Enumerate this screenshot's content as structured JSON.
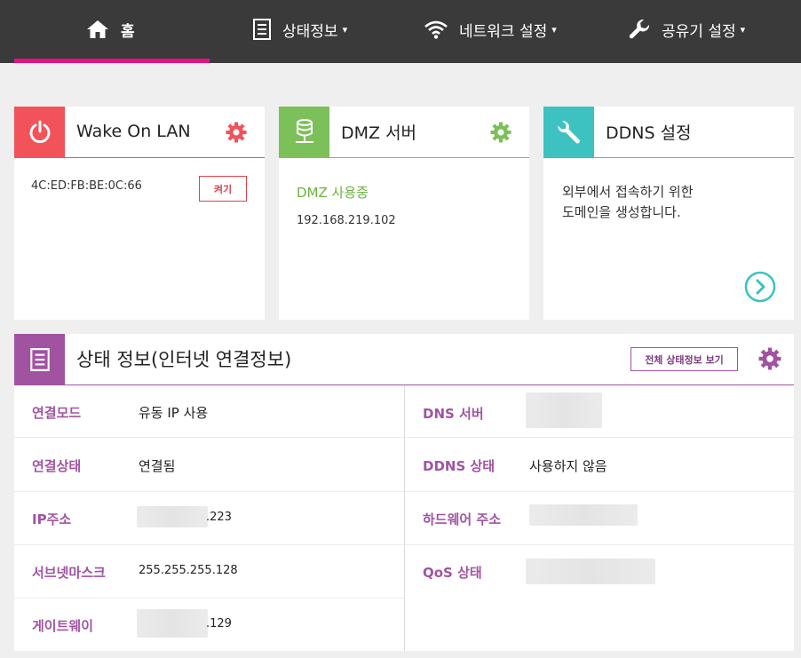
{
  "nav": {
    "home": "홈",
    "status": "상태정보",
    "network": "네트워크 설정",
    "router": "공유기 설정",
    "caret": "▾"
  },
  "wol": {
    "title": "Wake On LAN",
    "mac": "4C:ED:FB:BE:0C:66",
    "button": "켜기"
  },
  "dmz": {
    "title": "DMZ 서버",
    "status": "DMZ 사용중",
    "ip": "192.168.219.102"
  },
  "ddns": {
    "title": "DDNS 설정",
    "description_line1": "외부에서 접속하기 위한",
    "description_line2": "도메인을 생성합니다."
  },
  "status": {
    "title": "상태 정보(인터넷 연결정보)",
    "full_button": "전체 상태정보 보기",
    "left": [
      {
        "label": "연결모드",
        "value": "유동 IP 사용"
      },
      {
        "label": "연결상태",
        "value": "연결됨"
      },
      {
        "label": "IP주소",
        "value": ".223"
      },
      {
        "label": "서브넷마스크",
        "value": "255.255.255.128"
      },
      {
        "label": "게이트웨이",
        "value": ".129"
      }
    ],
    "right": [
      {
        "label": "DNS 서버",
        "value": ""
      },
      {
        "label": "DDNS 상태",
        "value": "사용하지 않음"
      },
      {
        "label": "하드웨어 주소",
        "value": ""
      },
      {
        "label": "QoS 상태",
        "value": ""
      }
    ]
  },
  "colors": {
    "nav_bg": "#3a3a3a",
    "nav_active": "#e6127d",
    "wol_accent": "#f2525a",
    "dmz_accent": "#7cc05a",
    "ddns_accent": "#3ec1c1",
    "status_accent": "#a153a1"
  }
}
